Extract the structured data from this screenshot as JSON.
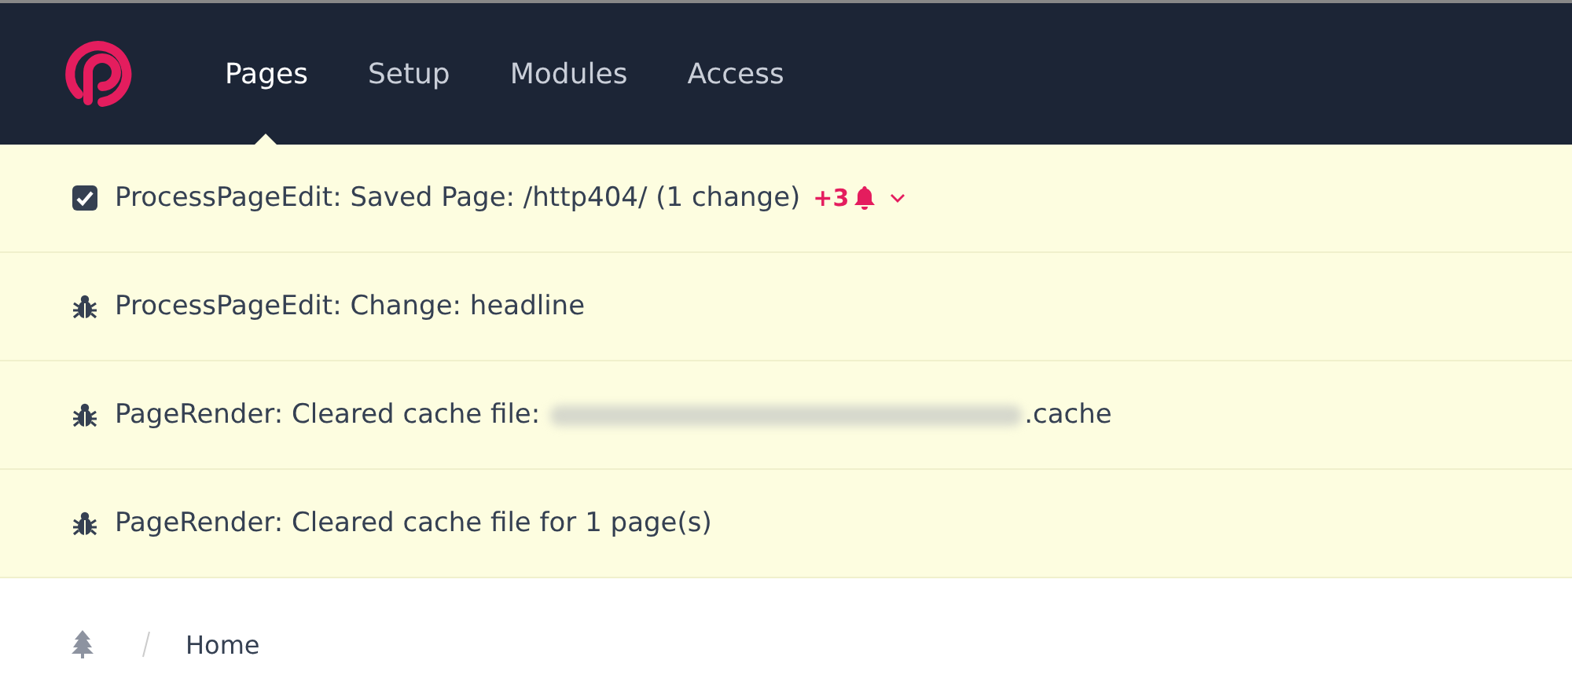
{
  "nav": {
    "items": [
      {
        "label": "Pages",
        "selected": true
      },
      {
        "label": "Setup",
        "selected": false
      },
      {
        "label": "Modules",
        "selected": false
      },
      {
        "label": "Access",
        "selected": false
      }
    ]
  },
  "notices": [
    {
      "kind": "check",
      "text": "ProcessPageEdit: Saved Page: /http404/ (1 change)",
      "count": "+3",
      "expandable": true
    },
    {
      "kind": "bug",
      "text": "ProcessPageEdit: Change: headline"
    },
    {
      "kind": "bug",
      "text": "PageRender: Cleared cache file:",
      "redacted": true,
      "suffix": ".cache"
    },
    {
      "kind": "bug",
      "text": "PageRender: Cleared cache file for 1 page(s)"
    }
  ],
  "breadcrumbs": [
    {
      "label": "Home"
    }
  ]
}
